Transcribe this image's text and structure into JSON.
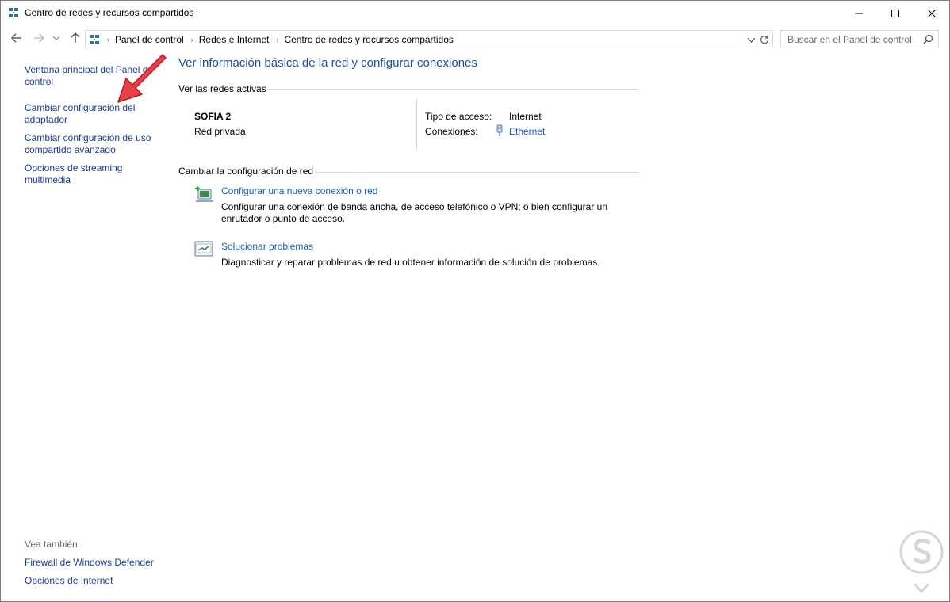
{
  "window": {
    "title": "Centro de redes y recursos compartidos"
  },
  "address_bar": {
    "crumbs": [
      "Panel de control",
      "Redes e Internet",
      "Centro de redes y recursos compartidos"
    ]
  },
  "search": {
    "placeholder": "Buscar en el Panel de control"
  },
  "left_pane": {
    "links": [
      "Ventana principal del Panel de control",
      "Cambiar configuración del adaptador",
      "Cambiar configuración de uso compartido avanzado",
      "Opciones de streaming multimedia"
    ],
    "see_also_label": "Vea también",
    "see_also_links": [
      "Firewall de Windows Defender",
      "Opciones de Internet"
    ]
  },
  "main": {
    "title": "Ver información básica de la red y configurar conexiones",
    "active_networks_header": "Ver las redes activas",
    "network": {
      "name": "SOFIA 2",
      "type": "Red privada",
      "access_label": "Tipo de acceso:",
      "access_value": "Internet",
      "connections_label": "Conexiones:",
      "connections_value": "Ethernet"
    },
    "change_header": "Cambiar la configuración de red",
    "tasks": [
      {
        "link": "Configurar una nueva conexión o red",
        "desc": "Configurar una conexión de banda ancha, de acceso telefónico o VPN; o bien configurar un enrutador o punto de acceso.",
        "icon": "new-connection-icon"
      },
      {
        "link": "Solucionar problemas",
        "desc": "Diagnosticar y reparar problemas de red u obtener información de solución de problemas.",
        "icon": "troubleshoot-icon"
      }
    ]
  },
  "colors": {
    "link": "#1a5fb4",
    "title": "#1e4e9b",
    "annotation_arrow": "#e8404a"
  }
}
